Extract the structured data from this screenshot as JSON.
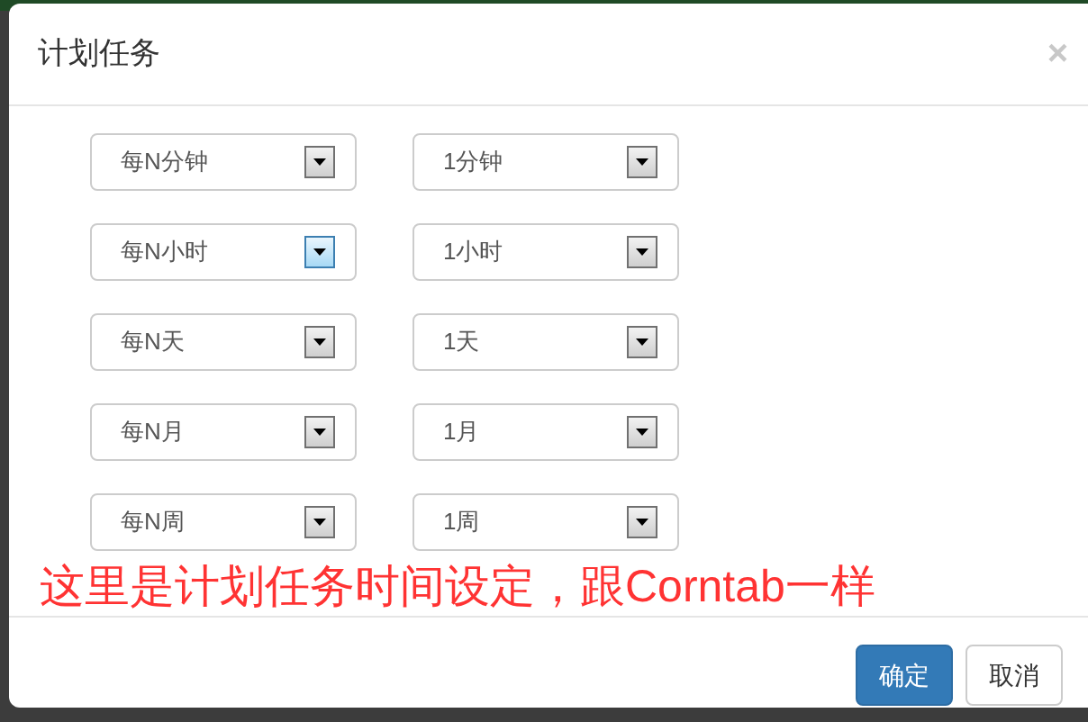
{
  "dialog": {
    "title": "计划任务",
    "close": "×"
  },
  "rows": [
    {
      "interval": {
        "value": "每N分钟",
        "hovered": false
      },
      "amount": {
        "value": "1分钟",
        "hovered": false
      }
    },
    {
      "interval": {
        "value": "每N小时",
        "hovered": true
      },
      "amount": {
        "value": "1小时",
        "hovered": false
      }
    },
    {
      "interval": {
        "value": "每N天",
        "hovered": false
      },
      "amount": {
        "value": "1天",
        "hovered": false
      }
    },
    {
      "interval": {
        "value": "每N月",
        "hovered": false
      },
      "amount": {
        "value": "1月",
        "hovered": false
      }
    },
    {
      "interval": {
        "value": "每N周",
        "hovered": false
      },
      "amount": {
        "value": "1周",
        "hovered": false
      }
    }
  ],
  "annotation": "这里是计划任务时间设定，跟Corntab一样",
  "buttons": [
    {
      "label": "确定",
      "kind": "primary"
    },
    {
      "label": "取消",
      "kind": "default"
    }
  ]
}
